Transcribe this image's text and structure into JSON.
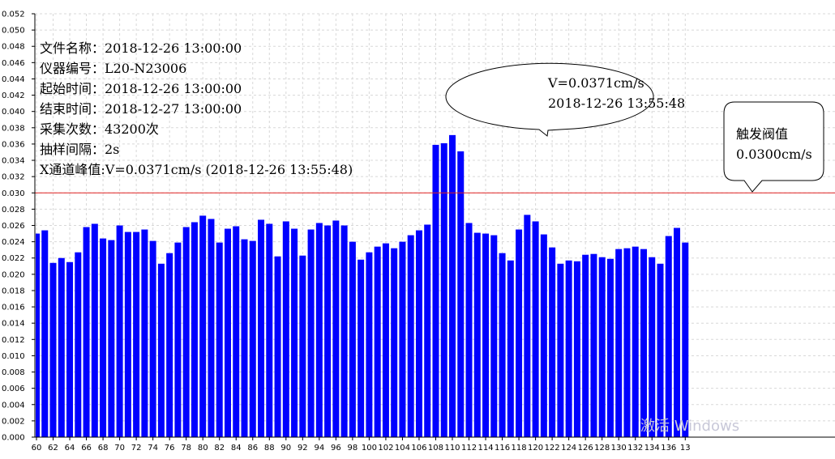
{
  "chart_data": {
    "type": "bar",
    "x_start": 60,
    "x_end": 137,
    "x_tick_step": 2,
    "ylim": [
      0,
      0.052
    ],
    "y_tick_step": 0.002,
    "grid": true,
    "bar_color": "#0000ff",
    "threshold": {
      "value": 0.03,
      "color": "#e02020"
    },
    "values": [
      0.025,
      0.0254,
      0.0214,
      0.022,
      0.0215,
      0.0227,
      0.0258,
      0.0262,
      0.0244,
      0.0242,
      0.026,
      0.0252,
      0.0252,
      0.0255,
      0.0241,
      0.0213,
      0.0226,
      0.0239,
      0.0258,
      0.0264,
      0.0272,
      0.0268,
      0.0239,
      0.0256,
      0.0259,
      0.0243,
      0.0241,
      0.0267,
      0.0262,
      0.0222,
      0.0265,
      0.0256,
      0.0223,
      0.0255,
      0.0263,
      0.026,
      0.0266,
      0.026,
      0.024,
      0.0218,
      0.0227,
      0.0234,
      0.0238,
      0.0232,
      0.024,
      0.0248,
      0.0254,
      0.0261,
      0.0359,
      0.0361,
      0.0371,
      0.0351,
      0.0263,
      0.0251,
      0.025,
      0.0248,
      0.0226,
      0.0217,
      0.0255,
      0.0273,
      0.0265,
      0.0249,
      0.0233,
      0.0213,
      0.0217,
      0.0216,
      0.0224,
      0.0225,
      0.0221,
      0.0219,
      0.0231,
      0.0232,
      0.0234,
      0.0231,
      0.0221,
      0.0213,
      0.0247,
      0.0257,
      0.0239
    ],
    "y_tick_labels": [
      "0.000",
      "0.002",
      "0.004",
      "0.006",
      "0.008",
      "0.010",
      "0.012",
      "0.014",
      "0.016",
      "0.018",
      "0.020",
      "0.022",
      "0.024",
      "0.026",
      "0.028",
      "0.030",
      "0.032",
      "0.034",
      "0.036",
      "0.038",
      "0.040",
      "0.042",
      "0.044",
      "0.046",
      "0.048",
      "0.050",
      "0.052"
    ],
    "x_tick_labels": [
      "60",
      "62",
      "64",
      "66",
      "68",
      "70",
      "72",
      "74",
      "76",
      "78",
      "80",
      "82",
      "84",
      "86",
      "88",
      "90",
      "92",
      "94",
      "96",
      "98",
      "100",
      "102",
      "104",
      "106",
      "108",
      "110",
      "112",
      "114",
      "116",
      "118",
      "120",
      "122",
      "124",
      "126",
      "128",
      "130",
      "132",
      "134",
      "136",
      "13"
    ]
  },
  "info": {
    "file_name": "文件名称：2018-12-26 13:00:00",
    "instrument": "仪器编号：L20-N23006",
    "start_time": "起始时间：2018-12-26 13:00:00",
    "end_time": "结束时间：2018-12-27 13:00:00",
    "sample_count": "采集次数：43200次",
    "sample_interval": "抽样间隔：2s",
    "peak": "X通道峰值:V=0.0371cm/s  (2018-12-26 13:55:48)"
  },
  "peak_callout": {
    "line1": "V=0.0371cm/s",
    "line2": "2018-12-26 13:55:48"
  },
  "threshold_callout": {
    "line1": "触发阀值",
    "line2": "0.0300cm/s"
  },
  "watermark": "激活 Windows"
}
